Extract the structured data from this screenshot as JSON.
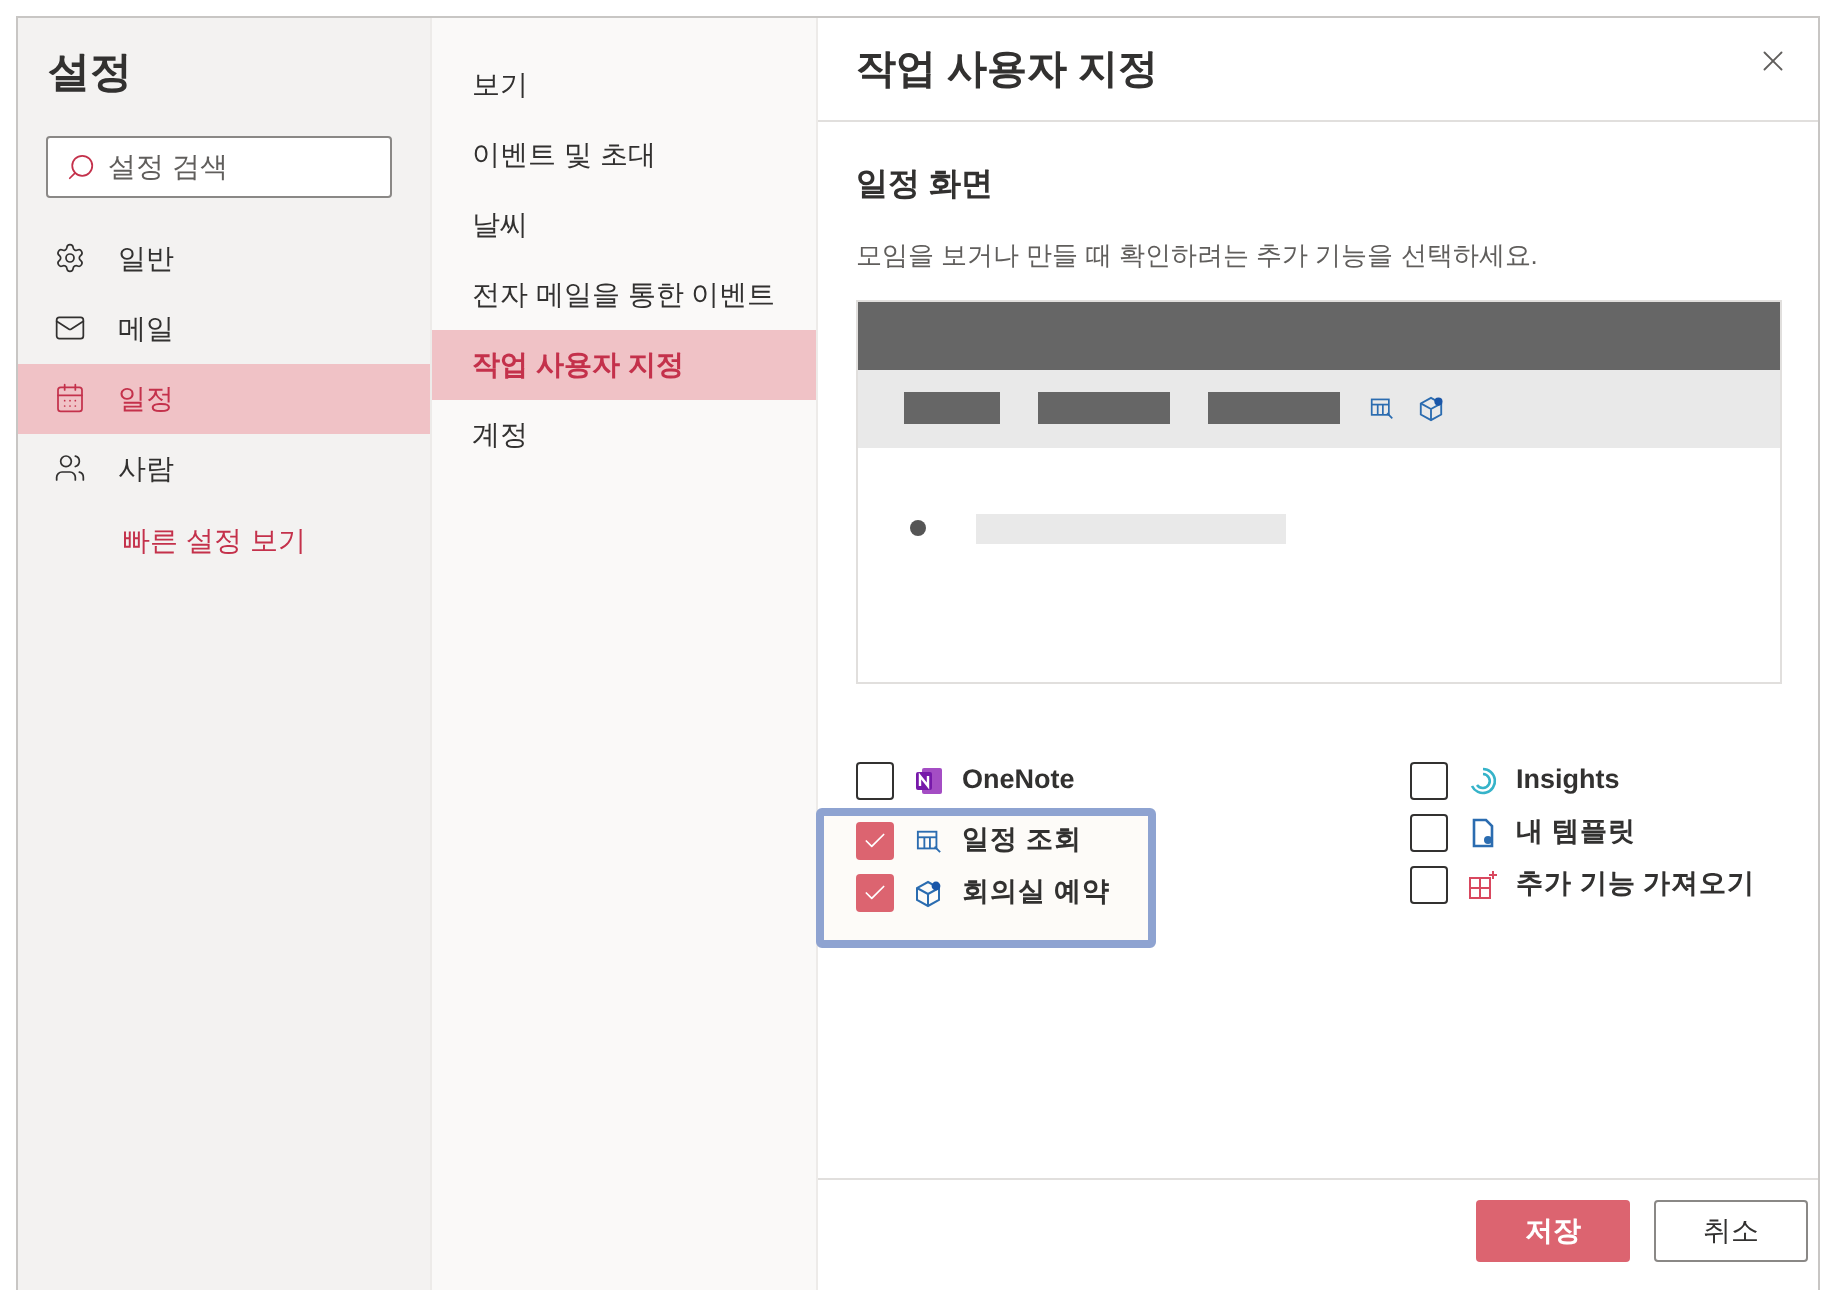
{
  "sidebar": {
    "title": "설정",
    "search": {
      "placeholder": "설정 검색"
    },
    "items": [
      {
        "label": "일반",
        "kind": "gear",
        "selected": false
      },
      {
        "label": "메일",
        "kind": "mail",
        "selected": false
      },
      {
        "label": "일정",
        "kind": "calendar",
        "selected": true
      },
      {
        "label": "사람",
        "kind": "people",
        "selected": false
      }
    ],
    "link": "빠른 설정 보기"
  },
  "subnav": {
    "items": [
      {
        "label": "보기",
        "selected": false
      },
      {
        "label": "이벤트 및 초대",
        "selected": false
      },
      {
        "label": "날씨",
        "selected": false
      },
      {
        "label": "전자 메일을 통한 이벤트",
        "selected": false
      },
      {
        "label": "작업 사용자 지정",
        "selected": true
      },
      {
        "label": "계정",
        "selected": false
      }
    ]
  },
  "panel": {
    "title": "작업 사용자 지정",
    "section": "일정 화면",
    "description": "모임을 보거나 만들 때 확인하려는 추가 기능을 선택하세요.",
    "columns": [
      [
        {
          "label": "OneNote",
          "kind": "onenote",
          "checked": false,
          "highlighted": false
        },
        {
          "label": "일정 조회",
          "kind": "calendar-search",
          "checked": true,
          "highlighted": true
        },
        {
          "label": "회의실 예약",
          "kind": "cube",
          "checked": true,
          "highlighted": true
        }
      ],
      [
        {
          "label": "Insights",
          "kind": "insights",
          "checked": false,
          "highlighted": false
        },
        {
          "label": "내 템플릿",
          "kind": "template",
          "checked": false,
          "highlighted": false
        },
        {
          "label": "추가 기능 가져오기",
          "kind": "addin",
          "checked": false,
          "highlighted": false
        }
      ]
    ],
    "buttons": [
      {
        "label": "저장",
        "kind": "primary"
      },
      {
        "label": "취소",
        "kind": "secondary"
      }
    ]
  }
}
